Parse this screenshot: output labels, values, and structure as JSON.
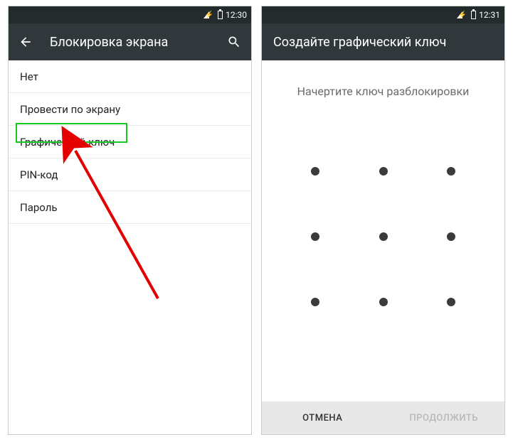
{
  "left": {
    "status": {
      "time": "12:30"
    },
    "appbar": {
      "title": "Блокировка экрана"
    },
    "options": [
      {
        "label": "Нет"
      },
      {
        "label": "Провести по экрану"
      },
      {
        "label": "Графический ключ",
        "highlighted": true
      },
      {
        "label": "PIN-код"
      },
      {
        "label": "Пароль"
      }
    ]
  },
  "right": {
    "status": {
      "time": "12:31"
    },
    "appbar": {
      "title": "Создайте графический ключ"
    },
    "instruction": "Начертите ключ разблокировки",
    "buttons": {
      "cancel": "ОТМЕНА",
      "continue": "ПРОДОЛЖИТЬ"
    }
  }
}
